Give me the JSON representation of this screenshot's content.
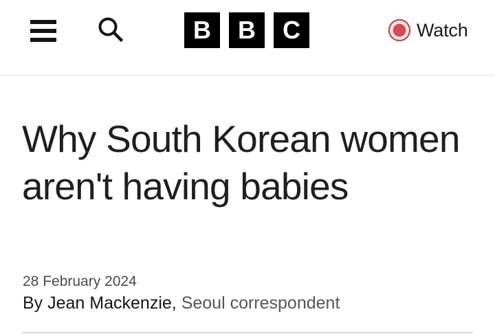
{
  "header": {
    "logo_letters": [
      "B",
      "B",
      "C"
    ],
    "watch_label": "Watch",
    "accent_color": "#e0464f",
    "icons": {
      "menu": "menu-icon",
      "search": "search-icon",
      "watch": "live-record-icon"
    }
  },
  "article": {
    "headline": "Why South Korean women aren't having babies",
    "date": "28 February 2024",
    "byline_prefix": "By ",
    "author": "Jean Mackenzie",
    "author_separator": ", ",
    "role": "Seoul correspondent"
  }
}
